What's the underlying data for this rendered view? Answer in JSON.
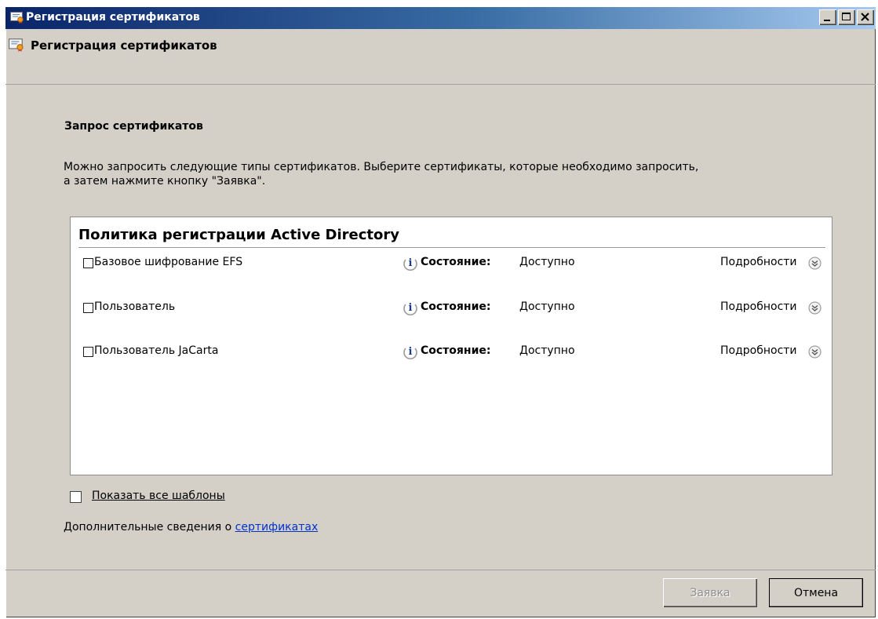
{
  "window": {
    "title": "Регистрация сертификатов",
    "minimize_label": "_",
    "maximize_label": "□",
    "close_label": "×"
  },
  "header": {
    "title": "Регистрация сертификатов"
  },
  "section": {
    "title": "Запрос сертификатов",
    "description_line1": "Можно запросить следующие типы сертификатов. Выберите сертификаты, которые необходимо запросить,",
    "description_line2": "а затем нажмите кнопку \"Заявка\"."
  },
  "policy": {
    "header": "Политика регистрации Active Directory",
    "items": [
      {
        "label": "Базовое шифрование EFS",
        "checked": false,
        "status_label": "Состояние:",
        "status_value": "Доступно",
        "details_label": "Подробности"
      },
      {
        "label": "Пользователь",
        "checked": false,
        "status_label": "Состояние:",
        "status_value": "Доступно",
        "details_label": "Подробности"
      },
      {
        "label": "Пользователь JaCarta",
        "checked": false,
        "status_label": "Состояние:",
        "status_value": "Доступно",
        "details_label": "Подробности"
      }
    ]
  },
  "options": {
    "show_all_label": "Показать все шаблоны",
    "show_all_checked": false
  },
  "footer": {
    "more_info_prefix": "Дополнительные сведения о ",
    "more_info_link": "сертификатах"
  },
  "buttons": {
    "enroll_label": "Заявка",
    "enroll_enabled": false,
    "cancel_label": "Отмена"
  },
  "colors": {
    "titlebar_start": "#0a246a",
    "titlebar_end": "#a6caf0",
    "dialog_bg": "#d4d0c8",
    "link": "#0033cc"
  },
  "icons": {
    "app": "certificate-icon",
    "info": "info-icon",
    "expand": "expand-down-icon"
  }
}
